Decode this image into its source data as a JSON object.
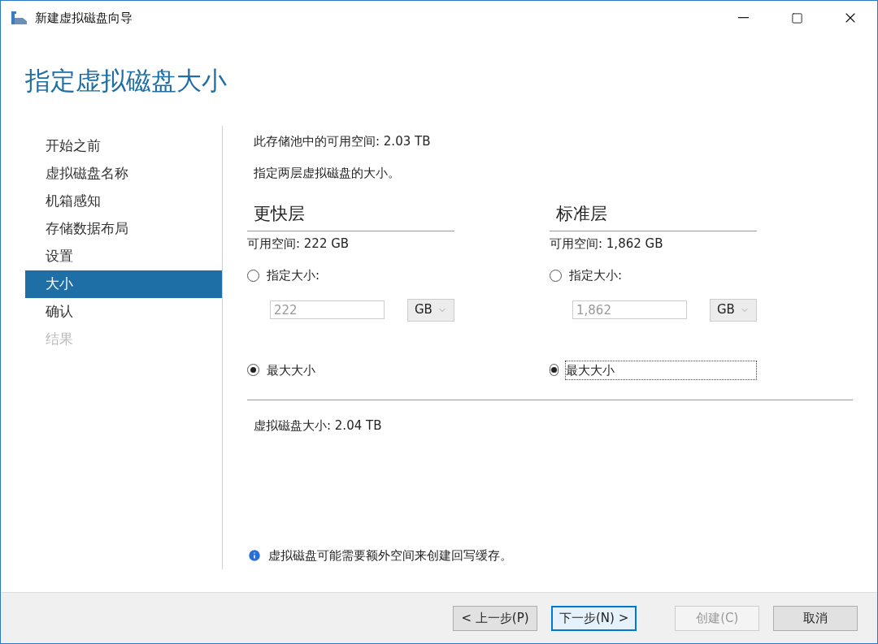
{
  "window": {
    "title": "新建虚拟磁盘向导"
  },
  "page_title": "指定虚拟磁盘大小",
  "steps": [
    {
      "label": "开始之前",
      "selected": false,
      "disabled": false
    },
    {
      "label": "虚拟磁盘名称",
      "selected": false,
      "disabled": false
    },
    {
      "label": "机箱感知",
      "selected": false,
      "disabled": false
    },
    {
      "label": "存储数据布局",
      "selected": false,
      "disabled": false
    },
    {
      "label": "设置",
      "selected": false,
      "disabled": false
    },
    {
      "label": "大小",
      "selected": true,
      "disabled": false
    },
    {
      "label": "确认",
      "selected": false,
      "disabled": false
    },
    {
      "label": "结果",
      "selected": false,
      "disabled": true
    }
  ],
  "pool_free": "此存储池中的可用空间: 2.03 TB",
  "instruction": "指定两层虚拟磁盘的大小。",
  "tiers": [
    {
      "name": "更快层",
      "free": "可用空间: 222 GB",
      "options": [
        {
          "label": "指定大小:",
          "selected": false,
          "focused": false
        },
        {
          "label": "最大大小",
          "selected": true,
          "focused": false
        }
      ],
      "size_value": "222",
      "unit": "GB",
      "disabled": true
    },
    {
      "name": "标准层",
      "free": "可用空间: 1,862 GB",
      "options": [
        {
          "label": "指定大小:",
          "selected": false,
          "focused": false
        },
        {
          "label": "最大大小",
          "selected": true,
          "focused": true
        }
      ],
      "size_value": "1,862",
      "unit": "GB",
      "disabled": true
    }
  ],
  "total": "虚拟磁盘大小: 2.04 TB",
  "note": "虚拟磁盘可能需要额外空间来创建回写缓存。",
  "buttons": [
    {
      "label": "< 上一步(P)",
      "kind": "normal"
    },
    {
      "label": "下一步(N) >",
      "kind": "default"
    },
    {
      "label": "创建(C)",
      "kind": "disabled"
    },
    {
      "label": "取消",
      "kind": "normal"
    }
  ]
}
